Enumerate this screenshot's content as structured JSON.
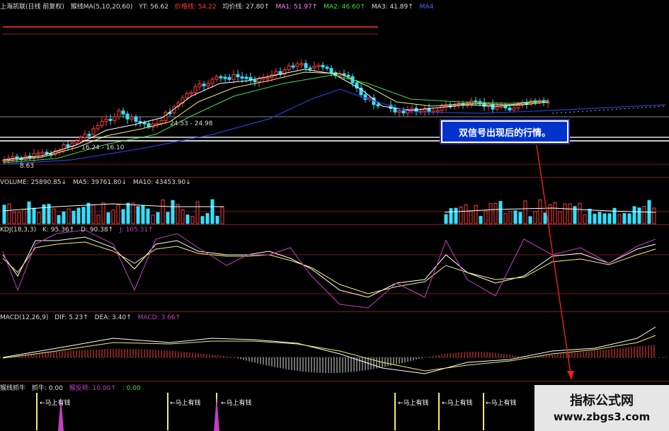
{
  "price_header": {
    "title": "上海凯联(日线 前复权)",
    "ma_label": "猴线MA(5,10,20,60)",
    "yt": "YT: 56.62",
    "red_label": "价格线: 54.22",
    "avg": "均价线: 27.80↑",
    "ma1": "MA1: 51.97↑",
    "ma2": "MA2: 46.60↑",
    "ma3": "MA3: 41.89↑",
    "ma4": "MA4"
  },
  "price_annotations": {
    "mid": "24.53 - 24.98",
    "low1": "16.24 - 16.10",
    "low2": "8.63"
  },
  "volume_header": {
    "label": "VOLUME: 25890.85↓",
    "ma5": "MA5: 39761.80↓",
    "ma10": "MA10: 43453.90↓"
  },
  "kdj_header": {
    "label": "KDJ(18,3,3)",
    "k": "K: 95.36↑",
    "d": "D: 90.38↑",
    "j": "J: 105.31↑"
  },
  "macd_header": {
    "label": "MACD(12,26,9)",
    "dif": "DIF: 5.23↑",
    "dea": "DEA: 3.40↑",
    "macd": "MACD: 3.66↑"
  },
  "signal_header": {
    "label": "猴线抓牛",
    "zhua": "抓牛: 0.00",
    "purple": "猴反转: 10.00↑",
    "tail": ": 0.00"
  },
  "signal_label": "←马上有钱",
  "callout": "双信号出现后的行情。",
  "watermark": {
    "line1": "指标公式网",
    "line2": "www.zbgs3.com"
  },
  "colors": {
    "up": "#ff3b3b",
    "down": "#33e0ff",
    "ma_white": "#ffffff",
    "ma_yellow": "#f0f070",
    "ma_green": "#44dd44",
    "ma_blue": "#2a3bd0",
    "kdj_purple": "#c040c0",
    "grid_red": "#7a1a1a"
  }
}
